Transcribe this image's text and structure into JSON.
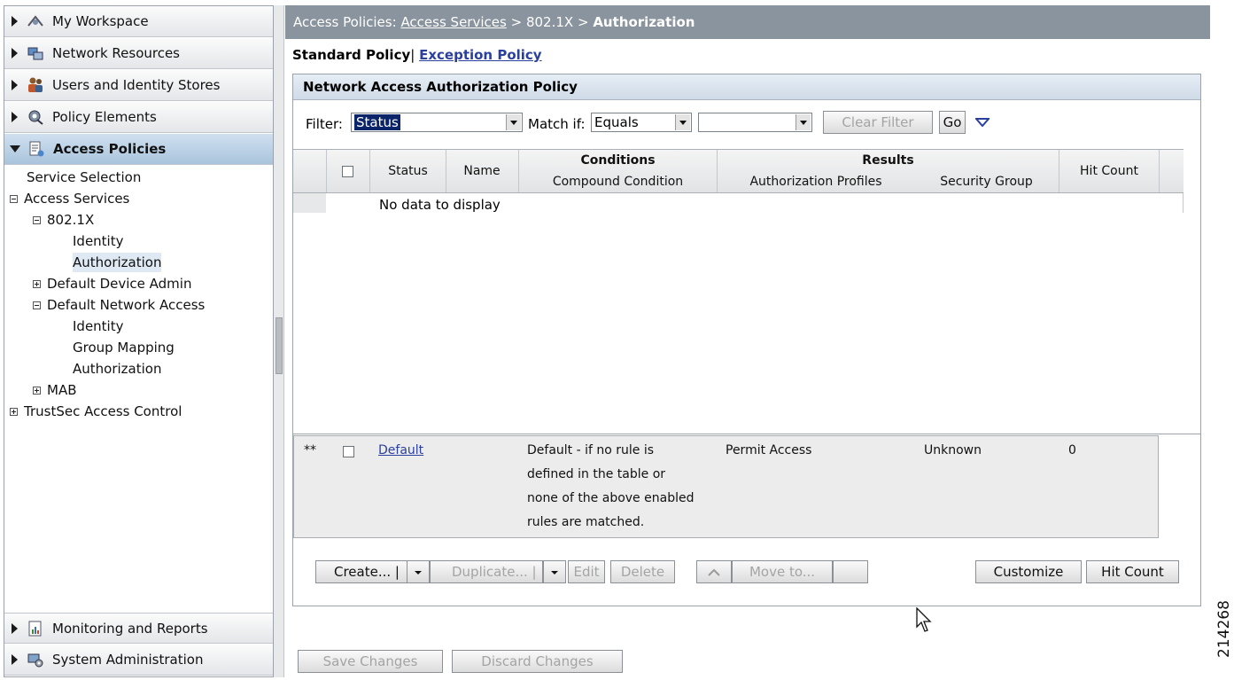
{
  "sidebar": {
    "top_drawers": [
      {
        "label": "My Workspace",
        "icon": "workspace-icon"
      },
      {
        "label": "Network Resources",
        "icon": "network-resources-icon"
      },
      {
        "label": "Users and Identity Stores",
        "icon": "users-icon"
      },
      {
        "label": "Policy Elements",
        "icon": "policy-elements-icon"
      },
      {
        "label": "Access Policies",
        "icon": "access-policies-icon",
        "expanded": true
      }
    ],
    "tree": [
      {
        "label": "Service Selection"
      },
      {
        "label": "Access Services",
        "toggle": "minus"
      },
      {
        "label": "802.1X",
        "toggle": "minus"
      },
      {
        "label": "Identity"
      },
      {
        "label": "Authorization",
        "selected": true
      },
      {
        "label": "Default Device Admin",
        "toggle": "plus"
      },
      {
        "label": "Default Network Access",
        "toggle": "minus"
      },
      {
        "label": "Identity"
      },
      {
        "label": "Group Mapping"
      },
      {
        "label": "Authorization"
      },
      {
        "label": "MAB",
        "toggle": "plus"
      },
      {
        "label": "TrustSec Access Control",
        "toggle": "plus"
      }
    ],
    "bottom_drawers": [
      {
        "label": "Monitoring and Reports",
        "icon": "reports-icon"
      },
      {
        "label": "System Administration",
        "icon": "system-admin-icon"
      }
    ]
  },
  "breadcrumb": {
    "prefix": "Access Policies:",
    "link": "Access Services",
    "sep1": ">",
    "mid": "802.1X",
    "sep2": ">",
    "current": "Authorization"
  },
  "policy_tabs": {
    "current": "Standard Policy",
    "divider": "|",
    "other": "Exception Policy"
  },
  "panel": {
    "title": "Network Access Authorization Policy",
    "filter": {
      "label": "Filter:",
      "value": "Status",
      "match_label": "Match if:",
      "match_value": "Equals",
      "third_value": "",
      "clear_label": "Clear Filter",
      "go_label": "Go"
    },
    "columns": {
      "status": "Status",
      "name": "Name",
      "conditions_group": "Conditions",
      "compound": "Compound Condition",
      "results_group": "Results",
      "auth_profiles": "Authorization Profiles",
      "security_group": "Security Group",
      "hit_count": "Hit Count"
    },
    "empty_text": "No data to display",
    "default_row": {
      "marker": "**",
      "name": "Default",
      "condition": [
        "Default - if no rule is",
        "defined in the table or",
        "none of the above enabled",
        "rules are matched."
      ],
      "auth_profile": "Permit Access",
      "security_group": "Unknown",
      "hit_count": "0"
    },
    "toolbar": {
      "create": "Create... |",
      "duplicate": "Duplicate... |",
      "edit": "Edit",
      "delete": "Delete",
      "move_to": "Move to...",
      "customize": "Customize",
      "hit_count": "Hit Count"
    }
  },
  "footer": {
    "save": "Save Changes",
    "discard": "Discard Changes"
  },
  "figure_number": "214268"
}
